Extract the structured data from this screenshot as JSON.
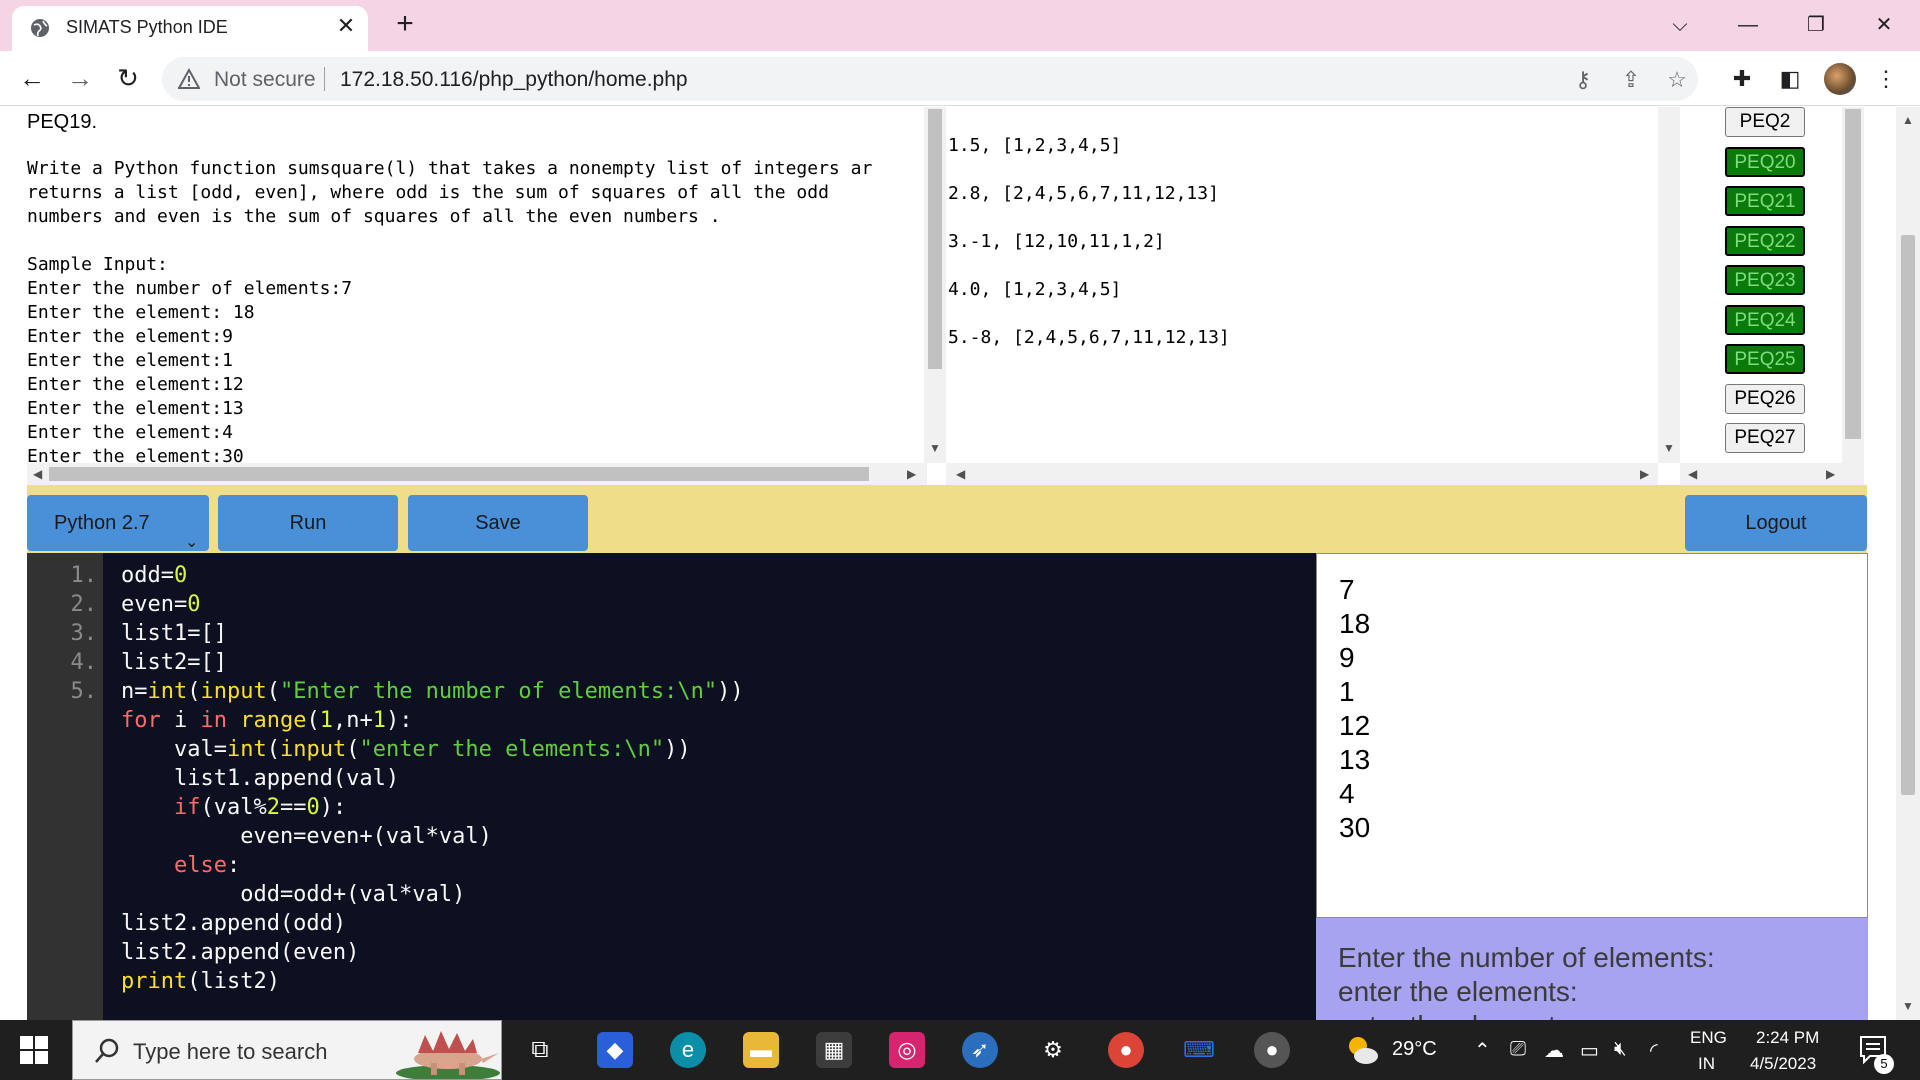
{
  "browser": {
    "tab_title": "SIMATS Python IDE",
    "security_label": "Not secure",
    "url": "172.18.50.116/php_python/home.php"
  },
  "question": {
    "id": "PEQ19.",
    "lines": [
      "Write a Python function sumsquare(l) that takes a nonempty list of integers ar",
      "returns a list [odd, even], where odd is the sum of squares of all the odd",
      "numbers and even is the sum of squares of all the even numbers .",
      "",
      "Sample Input:",
      "Enter the number of elements:7",
      "Enter the element: 18",
      "Enter the element:9",
      "Enter the element:1",
      "Enter the element:12",
      "Enter the element:13",
      "Enter the element:4",
      "Enter the element:30"
    ]
  },
  "test_cases": [
    "1.5, [1,2,3,4,5]",
    "2.8, [2,4,5,6,7,11,12,13]",
    "3.-1, [12,10,11,1,2]",
    "4.0, [1,2,3,4,5]",
    "5.-8, [2,4,5,6,7,11,12,13]"
  ],
  "problems": [
    {
      "label": "PEQ2",
      "completed": false
    },
    {
      "label": "PEQ20",
      "completed": true
    },
    {
      "label": "PEQ21",
      "completed": true
    },
    {
      "label": "PEQ22",
      "completed": true
    },
    {
      "label": "PEQ23",
      "completed": true
    },
    {
      "label": "PEQ24",
      "completed": true
    },
    {
      "label": "PEQ25",
      "completed": true
    },
    {
      "label": "PEQ26",
      "completed": false
    },
    {
      "label": "PEQ27",
      "completed": false
    }
  ],
  "controls": {
    "language": "Python 2.7",
    "run_label": "Run",
    "save_label": "Save",
    "logout_label": "Logout"
  },
  "editor": {
    "line_numbers": [
      "1.",
      "2.",
      "3.",
      "4.",
      "5."
    ],
    "code": [
      "odd=0",
      "even=0",
      "list1=[]",
      "list2=[]",
      "n=int(input(\"Enter the number of elements:\\n\"))",
      "for i in range(1,n+1):",
      "    val=int(input(\"enter the elements:\\n\"))",
      "    list1.append(val)",
      "    if(val%2==0):",
      "         even=even+(val*val)",
      "    else:",
      "         odd=odd+(val*val)",
      "list2.append(odd)",
      "list2.append(even)",
      "print(list2)"
    ]
  },
  "input_values": [
    "7",
    "18",
    "9",
    "1",
    "12",
    "13",
    "4",
    "30"
  ],
  "output_prompts": [
    "Enter the number of elements:",
    "enter the elements:",
    "enter the elements:"
  ],
  "taskbar": {
    "search_placeholder": "Type here to search",
    "temperature": "29°C",
    "lang_top": "ENG",
    "lang_bottom": "IN",
    "time": "2:24 PM",
    "date": "4/5/2023",
    "notification_count": "5"
  },
  "colors": {
    "completed_problem": "#0a7a0a",
    "control_bar": "#f0dd8a",
    "button_blue": "#4a90d9",
    "editor_bg": "#0c1021",
    "prompt_bg": "#a8a3f0"
  }
}
